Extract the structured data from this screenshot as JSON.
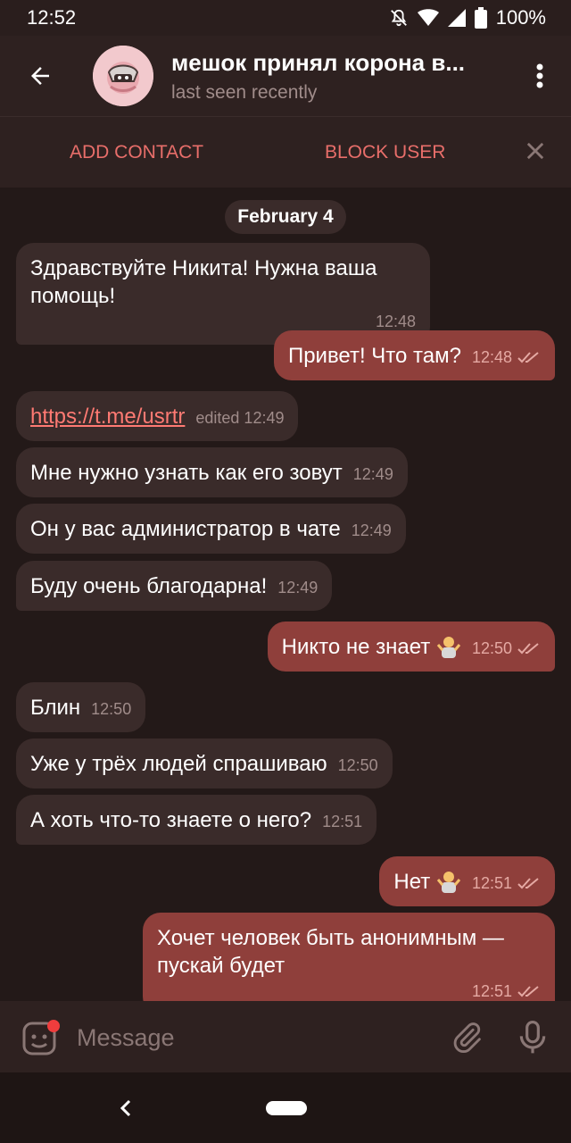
{
  "status": {
    "time": "12:52",
    "battery": "100%"
  },
  "header": {
    "title": "мешок принял корона в...",
    "subtitle": "last seen recently"
  },
  "actions": {
    "add_contact": "ADD CONTACT",
    "block_user": "BLOCK USER"
  },
  "chat": {
    "date": "February 4",
    "messages": [
      {
        "dir": "in",
        "text": "Здравствуйте Никита! Нужна ваша помощь!",
        "time": "12:48"
      },
      {
        "dir": "out",
        "text": "Привет! Что там?",
        "time": "12:48"
      },
      {
        "dir": "in",
        "text": "https://t.me/usrtr",
        "time": "edited 12:49",
        "link": true
      },
      {
        "dir": "in",
        "text": "Мне нужно узнать как его зовут",
        "time": "12:49"
      },
      {
        "dir": "in",
        "text": "Он у вас администратор в чате",
        "time": "12:49"
      },
      {
        "dir": "in",
        "text": "Буду очень благодарна!",
        "time": "12:49"
      },
      {
        "dir": "out",
        "text": "Никто не знает",
        "time": "12:50",
        "emoji": "person-shrugging"
      },
      {
        "dir": "in",
        "text": "Блин",
        "time": "12:50"
      },
      {
        "dir": "in",
        "text": "Уже у трёх людей спрашиваю",
        "time": "12:50"
      },
      {
        "dir": "in",
        "text": "А хоть что-то знаете о него?",
        "time": "12:51"
      },
      {
        "dir": "out",
        "text": "Нет",
        "time": "12:51",
        "emoji": "person-shrugging"
      },
      {
        "dir": "out",
        "text": "Хочет человек быть анонимным — пускай будет",
        "time": "12:51"
      }
    ]
  },
  "input": {
    "placeholder": "Message"
  },
  "colors": {
    "accent": "#e86e6a",
    "outgoing": "#8f3f3b",
    "incoming": "#3a2b2a",
    "background": "#231918"
  }
}
